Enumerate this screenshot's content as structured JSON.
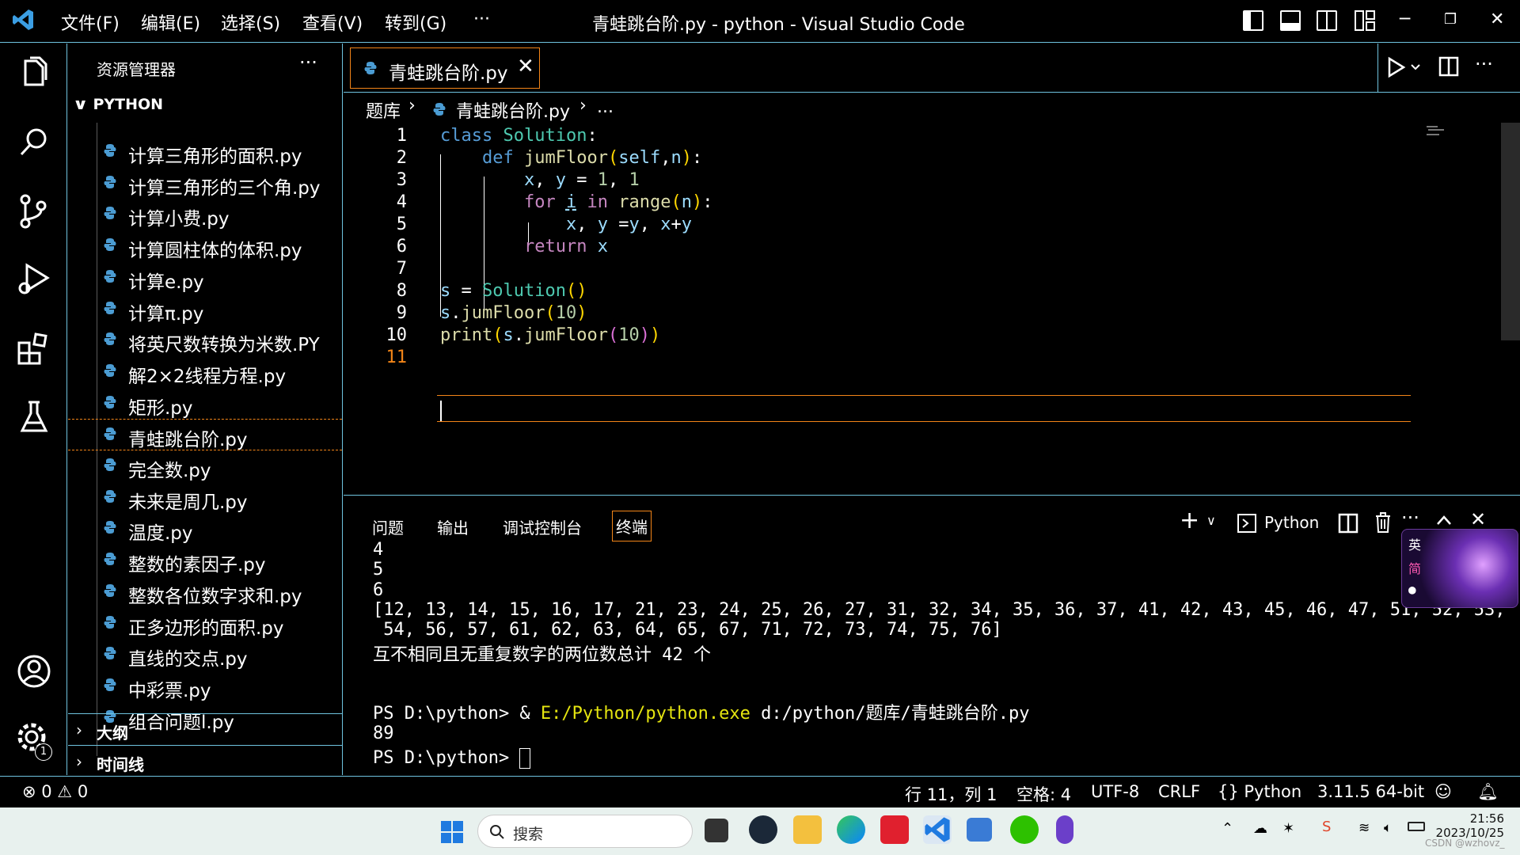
{
  "window": {
    "title": "青蛙跳台阶.py - python - Visual Studio Code",
    "menu": [
      "文件(F)",
      "编辑(E)",
      "选择(S)",
      "查看(V)",
      "转到(G)",
      "···"
    ]
  },
  "sidebar": {
    "title": "资源管理器",
    "section": "PYTHON",
    "files": [
      "计算三角形的面积.py",
      "计算三角形的三个角.py",
      "计算小费.py",
      "计算圆柱体的体积.py",
      "计算e.py",
      "计算π.py",
      "将英尺数转换为米数.PY",
      "解2×2线程方程.py",
      "矩形.py",
      "青蛙跳台阶.py",
      "完全数.py",
      "未来是周几.py",
      "温度.py",
      "整数的素因子.py",
      "整数各位数字求和.py",
      "正多边形的面积.py",
      "直线的交点.py",
      "中彩票.py",
      "组合问题l.py"
    ],
    "active_file": "青蛙跳台阶.py",
    "outline": "大纲",
    "timeline": "时间线"
  },
  "editor": {
    "tab": "青蛙跳台阶.py",
    "breadcrumb": [
      "题库",
      "青蛙跳台阶.py",
      "..."
    ],
    "lines": [
      "class Solution:",
      "    def jumFloor(self,n):",
      "        x, y = 1, 1",
      "        for i in range(n):",
      "            x, y =y, x+y",
      "        return x",
      "",
      "s = Solution()",
      "s.jumFloor(10)",
      "print(s.jumFloor(10))",
      ""
    ],
    "line_numbers": [
      "1",
      "2",
      "3",
      "4",
      "5",
      "6",
      "7",
      "8",
      "9",
      "10",
      "11"
    ],
    "current_line": "11"
  },
  "panel": {
    "tabs": [
      "问题",
      "输出",
      "调试控制台",
      "终端"
    ],
    "active_tab": "终端",
    "shell": "Python",
    "output": [
      "4",
      "5",
      "6",
      "[12, 13, 14, 15, 16, 17, 21, 23, 24, 25, 26, 27, 31, 32, 34, 35, 36, 37, 41, 42, 43, 45, 46, 47, 51, 52, 53,",
      " 54, 56, 57, 61, 62, 63, 64, 65, 67, 71, 72, 73, 74, 75, 76]",
      "互不相同且无重复数字的两位数总计 42 个"
    ],
    "cmd_prompt": "PS D:\\python> & ",
    "cmd_exe": "E:/Python/python.exe",
    "cmd_arg": " d:/python/题库/青蛙跳台阶.py",
    "result": "89",
    "final_prompt": "PS D:\\python> "
  },
  "statusbar": {
    "errors": "0",
    "warnings": "0",
    "position": "行 11，列 1",
    "spaces": "空格: 4",
    "encoding": "UTF-8",
    "eol": "CRLF",
    "language": "Python",
    "interpreter": "3.11.5 64-bit"
  },
  "taskbar": {
    "search_placeholder": "搜索",
    "time": "21:56",
    "date": "2023/10/25",
    "ime_lang": "英",
    "ime_mode": "简",
    "watermark": "CSDN @wzhovz_"
  },
  "colors": {
    "border": "#6fc3df",
    "focus": "#f38518",
    "taskbar": "#e8f1ee"
  },
  "activity_badge": "1"
}
